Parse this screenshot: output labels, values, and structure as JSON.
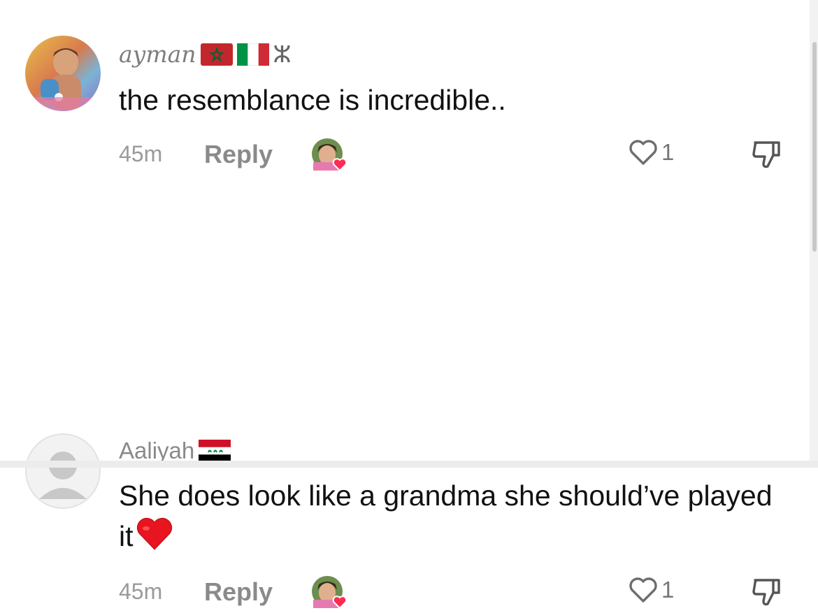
{
  "comments": [
    {
      "username": "ayman",
      "username_suffix": "ⵣ",
      "flags": [
        "morocco-flag",
        "italy-flag"
      ],
      "text": "the resemblance is incredible..",
      "time": "45m",
      "reply_label": "Reply",
      "like_count": "1",
      "creator_liked": true
    },
    {
      "username": "Aaliyah",
      "flags": [
        "iraq-flag"
      ],
      "text": "She does look like a grandma she should’ve played it",
      "emoji": "❤️",
      "time": "45m",
      "reply_label": "Reply",
      "like_count": "1",
      "creator_liked": true
    }
  ],
  "colors": {
    "heart_badge": "#fe2c55",
    "text": "#111111",
    "secondary": "#8a8a8a"
  },
  "icons": [
    "heart-outline-icon",
    "thumbs-down-icon",
    "default-avatar-icon"
  ]
}
